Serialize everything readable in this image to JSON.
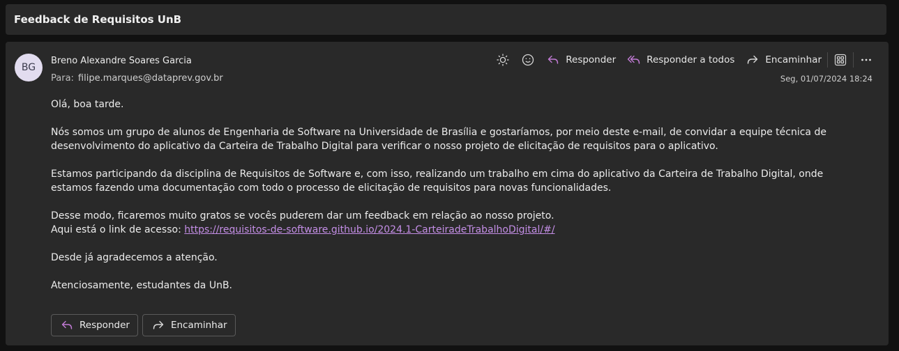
{
  "subject": "Feedback de Requisitos UnB",
  "sender": {
    "initials": "BG",
    "name": "Breno Alexandre Soares Garcia",
    "to_label": "Para:",
    "to_address": "filipe.marques@dataprev.gov.br"
  },
  "toolbar": {
    "reply": "Responder",
    "reply_all": "Responder a todos",
    "forward": "Encaminhar"
  },
  "date": "Seg, 01/07/2024 18:24",
  "body": {
    "greeting": "Olá, boa tarde.",
    "p1": "Nós somos um grupo de alunos de Engenharia de Software na Universidade de Brasília e gostaríamos, por meio deste e-mail, de convidar a equipe técnica de desenvolvimento do aplicativo da Carteira de Trabalho Digital para verificar o nosso projeto de elicitação de requisitos para o aplicativo.",
    "p2": "Estamos participando da disciplina de Requisitos de Software e, com isso, realizando um trabalho em cima do aplicativo da Carteira de Trabalho Digital, onde estamos fazendo uma documentação com todo o processo de elicitação de requisitos para novas funcionalidades.",
    "p3": "Desse modo, ficaremos muito gratos se vocês puderem dar um feedback em relação ao nosso projeto.",
    "link_prefix": "Aqui está o link de acesso: ",
    "link": "https://requisitos-de-software.github.io/2024.1-CarteiradeTrabalhoDigital/#/",
    "p4": "Desde já agradecemos a atenção.",
    "closing": "Atenciosamente, estudantes da UnB."
  },
  "bottom_actions": {
    "reply": "Responder",
    "forward": "Encaminhar"
  },
  "colors": {
    "accent_reply": "#c27bd6",
    "link": "#c48ee6",
    "card": "#292929",
    "background": "#111111"
  }
}
